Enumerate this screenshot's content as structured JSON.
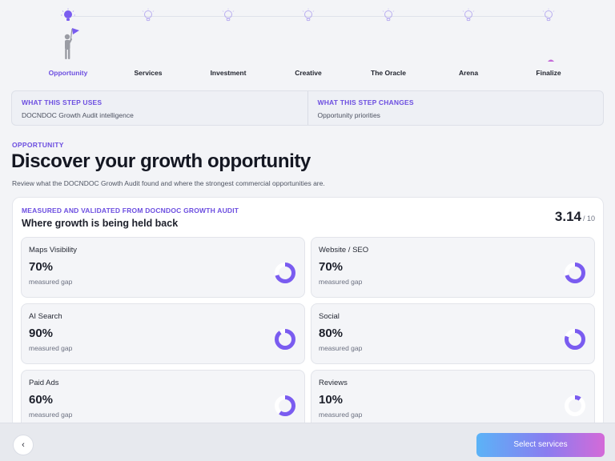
{
  "colors": {
    "accent": "#6c4ee0",
    "ring": "#7a5cf0",
    "ring_track": "#ffffff"
  },
  "stepper": {
    "steps": [
      {
        "label": "Opportunity",
        "icon": "lightbulb-icon",
        "active": true
      },
      {
        "label": "Services",
        "icon": "lightbulb-icon",
        "active": false
      },
      {
        "label": "Investment",
        "icon": "lightbulb-icon",
        "active": false
      },
      {
        "label": "Creative",
        "icon": "lightbulb-icon",
        "active": false
      },
      {
        "label": "The Oracle",
        "icon": "lightbulb-icon",
        "active": false
      },
      {
        "label": "Arena",
        "icon": "lightbulb-icon",
        "active": false
      },
      {
        "label": "Finalize",
        "icon": "lightbulb-icon",
        "active": false
      }
    ]
  },
  "info": {
    "uses_title": "WHAT THIS STEP USES",
    "uses_text": "DOCNDOC Growth Audit intelligence",
    "changes_title": "WHAT THIS STEP CHANGES",
    "changes_text": "Opportunity priorities"
  },
  "heading": {
    "eyebrow": "OPPORTUNITY",
    "title": "Discover your growth opportunity",
    "subtitle": "Review what the DOCNDOC Growth Audit found and where the strongest commercial opportunities are."
  },
  "card": {
    "eyebrow": "MEASURED AND VALIDATED FROM DOCNDOC GROWTH AUDIT",
    "title": "Where growth is being held back",
    "score": "3.14",
    "score_of": "/ 10",
    "tiles": [
      {
        "name": "Maps Visibility",
        "value": "70%",
        "caption": "measured gap",
        "fraction": 0.7
      },
      {
        "name": "Website / SEO",
        "value": "70%",
        "caption": "measured gap",
        "fraction": 0.7
      },
      {
        "name": "AI Search",
        "value": "90%",
        "caption": "measured gap",
        "fraction": 0.9
      },
      {
        "name": "Social",
        "value": "80%",
        "caption": "measured gap",
        "fraction": 0.8
      },
      {
        "name": "Paid Ads",
        "value": "60%",
        "caption": "measured gap",
        "fraction": 0.6
      },
      {
        "name": "Reviews",
        "value": "10%",
        "caption": "measured gap",
        "fraction": 0.1
      }
    ]
  },
  "footer": {
    "back_icon": "chevron-left-icon",
    "back_glyph": "‹",
    "next_label": "Select services"
  }
}
